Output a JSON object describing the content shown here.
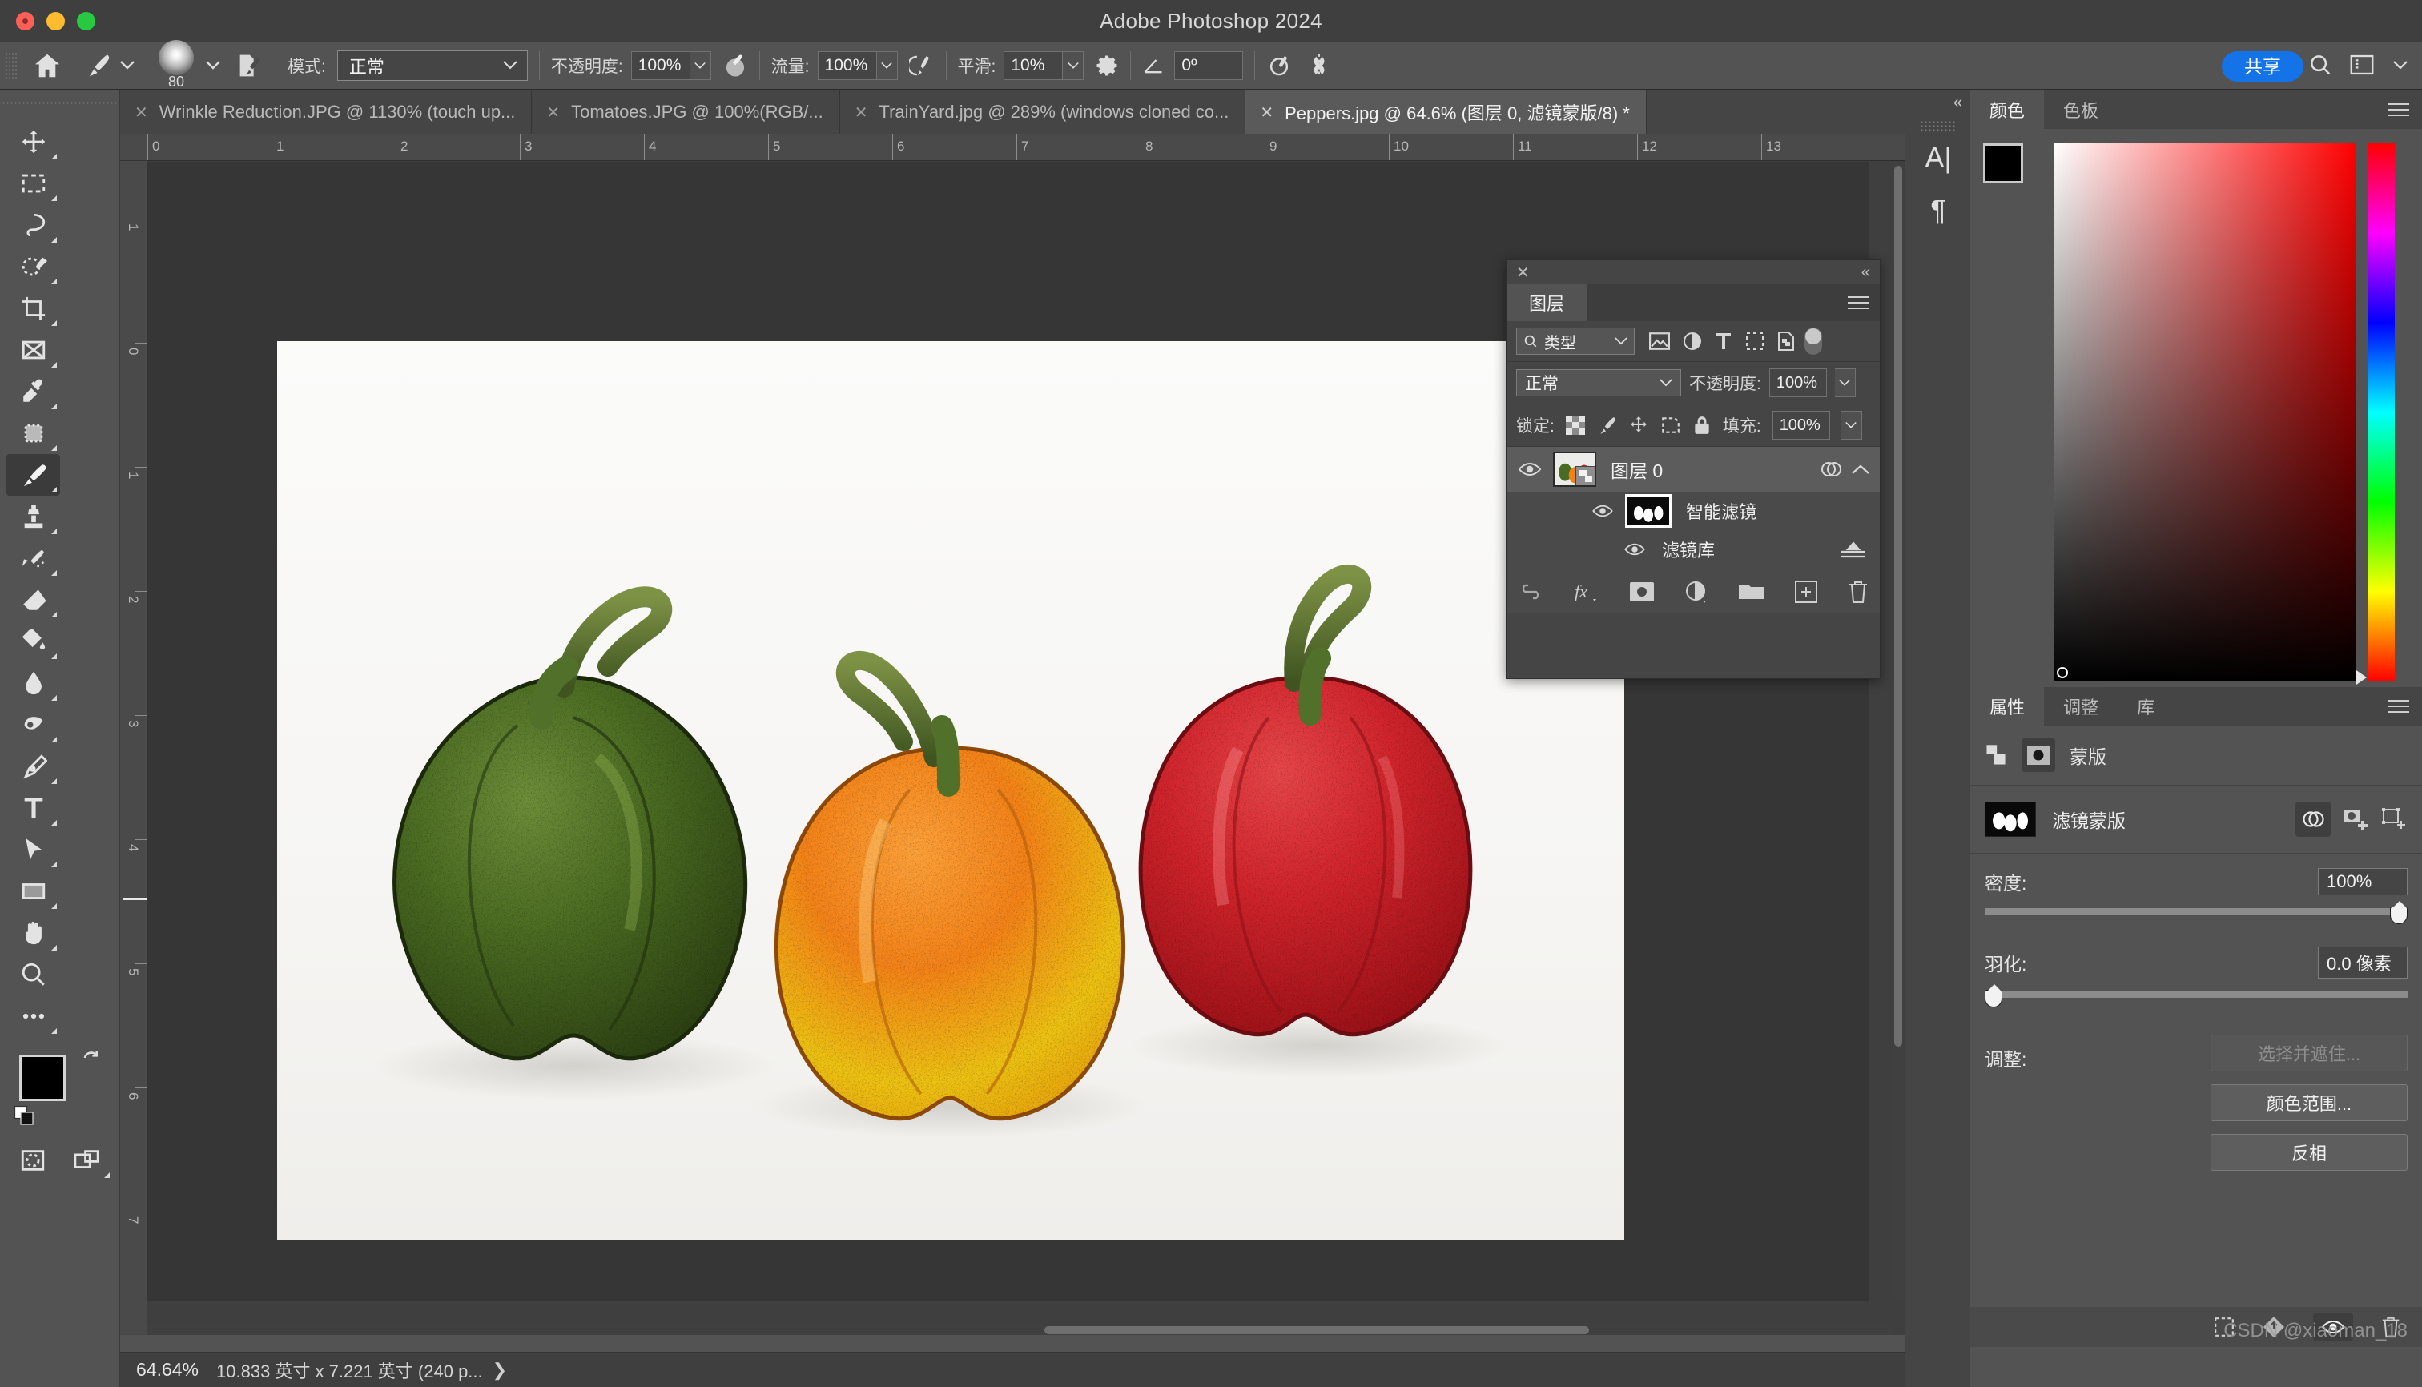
{
  "window": {
    "title": "Adobe Photoshop 2024"
  },
  "options_bar": {
    "home_icon": "home-icon",
    "brush_tool_icon": "brush-icon",
    "brush_size": "80",
    "brush_panel_icon": "brush-settings-icon",
    "mode_label": "模式:",
    "mode_value": "正常",
    "opacity_label": "不透明度:",
    "opacity_value": "100%",
    "pressure_opacity_icon": "pressure-opacity-icon",
    "flow_label": "流量:",
    "flow_value": "100%",
    "airbrush_icon": "airbrush-icon",
    "smoothing_label": "平滑:",
    "smoothing_value": "10%",
    "smoothing_gear_icon": "gear-icon",
    "angle_icon": "angle-icon",
    "angle_value": "0º",
    "pressure_size_icon": "pressure-size-icon",
    "symmetry_icon": "symmetry-icon",
    "share_label": "共享",
    "search_icon": "search-icon",
    "workspace_icon": "workspace-icon",
    "workspace_chevron_icon": "chevron-down-icon"
  },
  "tabs": [
    {
      "title": "Wrinkle Reduction.JPG @ 1130% (touch up...",
      "active": false,
      "close_icon": "close-icon"
    },
    {
      "title": "Tomatoes.JPG @ 100%(RGB/...",
      "active": false,
      "close_icon": "close-icon"
    },
    {
      "title": "TrainYard.jpg @ 289% (windows cloned co...",
      "active": false,
      "close_icon": "close-icon"
    },
    {
      "title": "Peppers.jpg @ 64.6% (图层 0, 滤镜蒙版/8) *",
      "active": true,
      "close_icon": "close-icon"
    }
  ],
  "toolbar": {
    "tools": [
      {
        "name": "move-tool",
        "icon": "move-icon",
        "selected": false
      },
      {
        "name": "marquee-tool",
        "icon": "rect-marquee-icon",
        "selected": false
      },
      {
        "name": "lasso-tool",
        "icon": "lasso-icon",
        "selected": false
      },
      {
        "name": "object-selection-tool",
        "icon": "quick-select-icon",
        "selected": false
      },
      {
        "name": "crop-tool",
        "icon": "crop-icon",
        "selected": false
      },
      {
        "name": "frame-tool",
        "icon": "frame-icon",
        "selected": false
      },
      {
        "name": "eyedropper-tool",
        "icon": "eyedropper-icon",
        "selected": false
      },
      {
        "name": "spot-healing-tool",
        "icon": "patch-icon",
        "selected": false
      },
      {
        "name": "brush-tool",
        "icon": "brush-icon",
        "selected": true
      },
      {
        "name": "clone-stamp-tool",
        "icon": "stamp-icon",
        "selected": false
      },
      {
        "name": "history-brush-tool",
        "icon": "history-brush-icon",
        "selected": false
      },
      {
        "name": "eraser-tool",
        "icon": "eraser-icon",
        "selected": false
      },
      {
        "name": "gradient-tool",
        "icon": "paint-bucket-icon",
        "selected": false
      },
      {
        "name": "blur-tool",
        "icon": "blur-drop-icon",
        "selected": false
      },
      {
        "name": "dodge-tool",
        "icon": "dodge-icon",
        "selected": false
      },
      {
        "name": "pen-tool",
        "icon": "pen-icon",
        "selected": false
      },
      {
        "name": "type-tool",
        "icon": "type-t-icon",
        "selected": false
      },
      {
        "name": "path-selection-tool",
        "icon": "arrow-cursor-icon",
        "selected": false
      },
      {
        "name": "shape-tool",
        "icon": "rectangle-icon",
        "selected": false
      },
      {
        "name": "hand-tool",
        "icon": "hand-icon",
        "selected": false
      },
      {
        "name": "zoom-tool",
        "icon": "magnifier-icon",
        "selected": false
      },
      {
        "name": "edit-toolbar",
        "icon": "ellipsis-icon",
        "selected": false
      }
    ],
    "foreground_color": "#000000",
    "background_color": "#ffffff",
    "swap_icon": "swap-colors-icon",
    "default_colors_icon": "default-colors-icon",
    "quickmask_icon": "quick-mask-icon",
    "screenmode_icon": "screen-mode-icon"
  },
  "rulers": {
    "unit_hint": "英寸",
    "horizontal_ticks": [
      "0",
      "1",
      "2",
      "3",
      "4",
      "5",
      "6",
      "7",
      "8",
      "9",
      "10",
      "11",
      "12",
      "13"
    ],
    "vertical_ticks": [
      "1",
      "0",
      "1",
      "2",
      "3",
      "4",
      "5",
      "6",
      "7"
    ]
  },
  "canvas": {
    "document_name": "Peppers.jpg",
    "artwork_description": "Three bell peppers (green, orange, red) illustrated with stipple/ink filter on white background"
  },
  "statusbar": {
    "zoom": "64.64%",
    "dimensions": "10.833 英寸 x 7.221 英寸 (240 p...",
    "expand_icon": "chevron-right-icon"
  },
  "layers_panel": {
    "close_icon": "close-icon",
    "collapse_icon": "double-chevron-left-icon",
    "tab_label": "图层",
    "menu_icon": "hamburger-menu-icon",
    "filter": {
      "search_icon": "search-icon",
      "type_label": "类型",
      "chevron_icon": "chevron-down-icon",
      "icons": [
        "pixel-filter-icon",
        "adjustment-filter-icon",
        "type-filter-icon",
        "shape-filter-icon",
        "smart-object-filter-icon"
      ],
      "toggle_name": "filter-enable-toggle"
    },
    "blend_mode": "正常",
    "blend_chevron_icon": "chevron-down-icon",
    "opacity_label": "不透明度:",
    "opacity_value": "100%",
    "opacity_chevron_icon": "chevron-down-icon",
    "lock_label": "锁定:",
    "lock_icons": [
      "lock-transparency-icon",
      "lock-image-icon",
      "lock-position-icon",
      "lock-artboard-icon",
      "lock-all-icon"
    ],
    "fill_label": "填充:",
    "fill_value": "100%",
    "fill_chevron_icon": "chevron-down-icon",
    "layers": [
      {
        "name": "图层 0",
        "visibility_icon": "eye-icon",
        "thumbnail": "peppers-layer-thumbnail",
        "smart_object_badge": "smart-object-icon",
        "fx_icon": "smart-filter-icon",
        "expand_icon": "chevron-up-icon",
        "selected": true
      }
    ],
    "smart_filters": {
      "label": "智能滤镜",
      "visibility_icon": "eye-icon",
      "mask_thumbnail": "filter-mask-thumbnail",
      "filters": [
        {
          "label": "滤镜库",
          "visibility_icon": "eye-icon",
          "options_icon": "blending-options-icon"
        }
      ]
    },
    "bottom_icons": [
      "link-layers-icon",
      "layer-style-fx-icon",
      "add-mask-icon",
      "adjustment-layer-icon",
      "new-group-icon",
      "new-layer-icon",
      "delete-layer-icon"
    ]
  },
  "right_rail": {
    "collapse_icon": "double-chevron-left-icon",
    "buttons": [
      {
        "name": "character-panel-icon",
        "glyph": "A|"
      },
      {
        "name": "paragraph-panel-icon",
        "glyph": "¶"
      }
    ]
  },
  "color_panel": {
    "tabs": [
      {
        "label": "颜色",
        "active": true
      },
      {
        "label": "色板",
        "active": false
      }
    ],
    "menu_icon": "hamburger-menu-icon",
    "foreground_color": "#000000",
    "background_color": "#ffffff",
    "picker_base_hue": "#ff0000",
    "hue_stops": [
      "#ff0000",
      "#ff00ff",
      "#0000ff",
      "#00ffff",
      "#00ff00",
      "#ffff00",
      "#ff0000"
    ]
  },
  "properties_panel": {
    "tabs": [
      {
        "label": "属性",
        "active": true
      },
      {
        "label": "调整",
        "active": false
      },
      {
        "label": "库",
        "active": false
      }
    ],
    "menu_icon": "hamburger-menu-icon",
    "header": {
      "smart_object_icon": "smart-object-icon",
      "mask_icon": "mask-icon",
      "title": "蒙版"
    },
    "mask_row": {
      "thumbnail": "filter-mask-thumbnail",
      "name": "滤镜蒙版",
      "icons": [
        "mask-select-icon",
        "add-pixel-mask-icon",
        "add-vector-mask-icon"
      ]
    },
    "density": {
      "label": "密度:",
      "value": "100%",
      "percent": 100
    },
    "feather": {
      "label": "羽化:",
      "value": "0.0 像素",
      "percent": 0
    },
    "adjust": {
      "label": "调整:",
      "buttons": [
        {
          "label": "选择并遮住...",
          "disabled": true
        },
        {
          "label": "颜色范围...",
          "disabled": false
        },
        {
          "label": "反相",
          "disabled": false
        }
      ]
    },
    "footer_icons": [
      "select-mask-icon",
      "apply-mask-icon",
      "toggle-mask-icon",
      "delete-mask-icon"
    ]
  },
  "watermark": {
    "text": "CSDN @xiaoman_18"
  }
}
